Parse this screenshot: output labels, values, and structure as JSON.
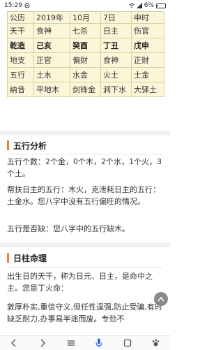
{
  "status_bar": {
    "time": "15:29",
    "battery": "6%"
  },
  "pillars_table": {
    "rows": [
      {
        "label": "公历",
        "cells": [
          "2019年",
          "10月",
          "7日",
          "申时"
        ],
        "bold": false
      },
      {
        "label": "天干",
        "cells": [
          "食神",
          "七杀",
          "日主",
          "伤官"
        ],
        "bold": false
      },
      {
        "label": "乾造",
        "cells": [
          "己亥",
          "癸酉",
          "丁丑",
          "戊申"
        ],
        "bold": true
      },
      {
        "label": "地支",
        "cells": [
          "正官",
          "偏财",
          "食神",
          "正财"
        ],
        "bold": false
      },
      {
        "label": "五行",
        "cells": [
          "土水",
          "水金",
          "火土",
          "土金"
        ],
        "bold": false
      },
      {
        "label": "纳音",
        "cells": [
          "平地木",
          "剑锋金",
          "涧下水",
          "大驿土"
        ],
        "bold": false
      }
    ]
  },
  "wuxing_section": {
    "title": "五行分析",
    "p1": "五行个数：2个金，0个木，2个水，1个火，3个土。",
    "p2": "帮扶日主的五行：木火，克泄耗日主的五行：土金水。您八字中没有五行偏旺的情况。",
    "p3": "五行是否缺：您八字中的五行缺木。"
  },
  "rizhu_section": {
    "title": "日柱命理",
    "p1": "出生日的天干，称为日元、日主，是命中之主。您是丁火命：",
    "p2": "敦厚朴实,重信守义,但任性逞强,防止受骗,有时缺乏耐力,办事易半途而废。专劲不"
  },
  "colors": {
    "accent": "#f47b2a",
    "table_bg": "#fcf6d9",
    "nav_active": "#2a6fe6"
  },
  "nav": {
    "items": [
      "back-icon",
      "forward-icon",
      "menu-icon",
      "voice-icon",
      "tabs-icon",
      "home-icon"
    ]
  }
}
